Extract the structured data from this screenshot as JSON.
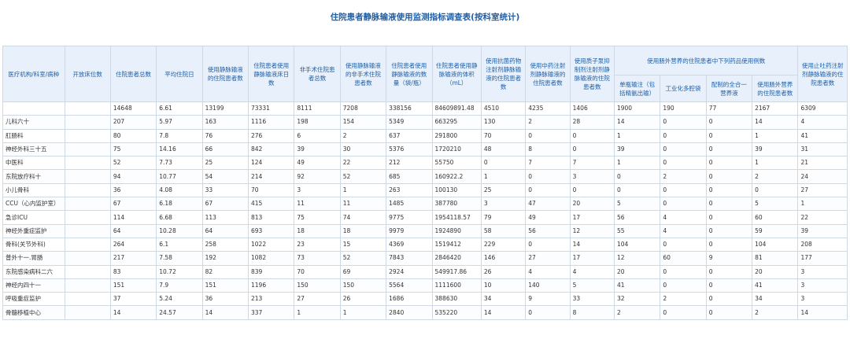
{
  "title": "住院患者静脉输液使用监测指标调查表(按科室统计)",
  "headers": {
    "dept": "医疗机构/科室/病种",
    "beds": "开放床位数",
    "inpatients": "住院患者总数",
    "avg_stay": "平均住院日",
    "iv_patients": "使用静脉输液的住院患者数",
    "iv_bed_days": "住院患者使用静脉输液床日数",
    "non_surgical": "非手术住院患者总数",
    "non_surgical_iv": "使用静脉输液的非手术住院患者数",
    "iv_amount": "住院患者使用静脉输液的数量（袋/瓶）",
    "iv_volume": "住院患者使用静脉输液的体积（mL）",
    "antibiotic_iv": "使用抗菌药物注射剂静脉输液的住院患者数",
    "tcm_iv": "使用中药注射剂静脉输液的住院患者数",
    "pump_iv": "使用质子泵抑制剂注射剂静脉输液的住院患者数",
    "parenteral_group": "使用肠外营养的住院患者中下列药品使用例数",
    "single_bottle": "单瓶输注（包括精氨出输）",
    "industrial_bags": "工业化多腔袋",
    "compounded": "配制的全合一营养液",
    "parenteral_patients": "使用肠外营养的住院患者数",
    "antiemetic_iv": "使用止吐药注射剂静脉输液的住院患者数"
  },
  "rows": [
    {
      "dept": "",
      "beds": "",
      "inpatients": "14648",
      "avg_stay": "6.61",
      "iv_patients": "13199",
      "iv_bed_days": "73331",
      "non_surgical": "8111",
      "non_surgical_iv": "7208",
      "iv_amount": "338156",
      "iv_volume": "84609891.48",
      "antibiotic_iv": "4510",
      "tcm_iv": "4235",
      "pump_iv": "1406",
      "single_bottle": "1900",
      "industrial_bags": "190",
      "compounded": "77",
      "parenteral_patients": "2167",
      "antiemetic_iv": "6309"
    },
    {
      "dept": "儿科六十",
      "beds": "",
      "inpatients": "207",
      "avg_stay": "5.97",
      "iv_patients": "163",
      "iv_bed_days": "1116",
      "non_surgical": "198",
      "non_surgical_iv": "154",
      "iv_amount": "5349",
      "iv_volume": "663295",
      "antibiotic_iv": "130",
      "tcm_iv": "2",
      "pump_iv": "28",
      "single_bottle": "14",
      "industrial_bags": "0",
      "compounded": "0",
      "parenteral_patients": "14",
      "antiemetic_iv": "4"
    },
    {
      "dept": "肛肠科",
      "beds": "",
      "inpatients": "80",
      "avg_stay": "7.8",
      "iv_patients": "76",
      "iv_bed_days": "276",
      "non_surgical": "6",
      "non_surgical_iv": "2",
      "iv_amount": "637",
      "iv_volume": "291800",
      "antibiotic_iv": "70",
      "tcm_iv": "0",
      "pump_iv": "0",
      "single_bottle": "1",
      "industrial_bags": "0",
      "compounded": "0",
      "parenteral_patients": "1",
      "antiemetic_iv": "41"
    },
    {
      "dept": "神经外科三十五",
      "beds": "",
      "inpatients": "75",
      "avg_stay": "14.16",
      "iv_patients": "66",
      "iv_bed_days": "842",
      "non_surgical": "39",
      "non_surgical_iv": "30",
      "iv_amount": "5376",
      "iv_volume": "1720210",
      "antibiotic_iv": "48",
      "tcm_iv": "8",
      "pump_iv": "0",
      "single_bottle": "39",
      "industrial_bags": "0",
      "compounded": "0",
      "parenteral_patients": "39",
      "antiemetic_iv": "31"
    },
    {
      "dept": "中医科",
      "beds": "",
      "inpatients": "52",
      "avg_stay": "7.73",
      "iv_patients": "25",
      "iv_bed_days": "124",
      "non_surgical": "49",
      "non_surgical_iv": "22",
      "iv_amount": "212",
      "iv_volume": "55750",
      "antibiotic_iv": "0",
      "tcm_iv": "7",
      "pump_iv": "7",
      "single_bottle": "1",
      "industrial_bags": "0",
      "compounded": "0",
      "parenteral_patients": "1",
      "antiemetic_iv": "21"
    },
    {
      "dept": "东院放疗科十",
      "beds": "",
      "inpatients": "94",
      "avg_stay": "10.77",
      "iv_patients": "54",
      "iv_bed_days": "214",
      "non_surgical": "92",
      "non_surgical_iv": "52",
      "iv_amount": "685",
      "iv_volume": "160922.2",
      "antibiotic_iv": "1",
      "tcm_iv": "0",
      "pump_iv": "3",
      "single_bottle": "0",
      "industrial_bags": "2",
      "compounded": "0",
      "parenteral_patients": "2",
      "antiemetic_iv": "24"
    },
    {
      "dept": "小儿骨科",
      "beds": "",
      "inpatients": "36",
      "avg_stay": "4.08",
      "iv_patients": "33",
      "iv_bed_days": "70",
      "non_surgical": "3",
      "non_surgical_iv": "1",
      "iv_amount": "263",
      "iv_volume": "100130",
      "antibiotic_iv": "25",
      "tcm_iv": "0",
      "pump_iv": "0",
      "single_bottle": "0",
      "industrial_bags": "0",
      "compounded": "0",
      "parenteral_patients": "0",
      "antiemetic_iv": "27"
    },
    {
      "dept": "CCU（心内监护室）",
      "beds": "",
      "inpatients": "67",
      "avg_stay": "6.18",
      "iv_patients": "67",
      "iv_bed_days": "415",
      "non_surgical": "11",
      "non_surgical_iv": "11",
      "iv_amount": "1485",
      "iv_volume": "387780",
      "antibiotic_iv": "3",
      "tcm_iv": "47",
      "pump_iv": "20",
      "single_bottle": "5",
      "industrial_bags": "0",
      "compounded": "0",
      "parenteral_patients": "5",
      "antiemetic_iv": "1"
    },
    {
      "dept": "急诊ICU",
      "beds": "",
      "inpatients": "114",
      "avg_stay": "6.68",
      "iv_patients": "113",
      "iv_bed_days": "813",
      "non_surgical": "75",
      "non_surgical_iv": "74",
      "iv_amount": "9775",
      "iv_volume": "1954118.57",
      "antibiotic_iv": "79",
      "tcm_iv": "49",
      "pump_iv": "17",
      "single_bottle": "56",
      "industrial_bags": "4",
      "compounded": "0",
      "parenteral_patients": "60",
      "antiemetic_iv": "22"
    },
    {
      "dept": "神经外重症监护",
      "beds": "",
      "inpatients": "64",
      "avg_stay": "10.28",
      "iv_patients": "64",
      "iv_bed_days": "693",
      "non_surgical": "18",
      "non_surgical_iv": "18",
      "iv_amount": "9979",
      "iv_volume": "1924890",
      "antibiotic_iv": "58",
      "tcm_iv": "56",
      "pump_iv": "12",
      "single_bottle": "55",
      "industrial_bags": "4",
      "compounded": "0",
      "parenteral_patients": "59",
      "antiemetic_iv": "39"
    },
    {
      "dept": "骨科(关节外科)",
      "beds": "",
      "inpatients": "264",
      "avg_stay": "6.1",
      "iv_patients": "258",
      "iv_bed_days": "1022",
      "non_surgical": "23",
      "non_surgical_iv": "15",
      "iv_amount": "4369",
      "iv_volume": "1519412",
      "antibiotic_iv": "229",
      "tcm_iv": "0",
      "pump_iv": "14",
      "single_bottle": "104",
      "industrial_bags": "0",
      "compounded": "0",
      "parenteral_patients": "104",
      "antiemetic_iv": "208"
    },
    {
      "dept": "普外十一.胃肠",
      "beds": "",
      "inpatients": "217",
      "avg_stay": "7.58",
      "iv_patients": "192",
      "iv_bed_days": "1082",
      "non_surgical": "73",
      "non_surgical_iv": "52",
      "iv_amount": "7843",
      "iv_volume": "2846420",
      "antibiotic_iv": "146",
      "tcm_iv": "27",
      "pump_iv": "17",
      "single_bottle": "12",
      "industrial_bags": "60",
      "compounded": "9",
      "parenteral_patients": "81",
      "antiemetic_iv": "177"
    },
    {
      "dept": "东院感染病科二六",
      "beds": "",
      "inpatients": "83",
      "avg_stay": "10.72",
      "iv_patients": "82",
      "iv_bed_days": "839",
      "non_surgical": "70",
      "non_surgical_iv": "69",
      "iv_amount": "2924",
      "iv_volume": "549917.86",
      "antibiotic_iv": "26",
      "tcm_iv": "4",
      "pump_iv": "4",
      "single_bottle": "20",
      "industrial_bags": "0",
      "compounded": "0",
      "parenteral_patients": "20",
      "antiemetic_iv": "3"
    },
    {
      "dept": "神经内四十一",
      "beds": "",
      "inpatients": "151",
      "avg_stay": "7.9",
      "iv_patients": "151",
      "iv_bed_days": "1196",
      "non_surgical": "150",
      "non_surgical_iv": "150",
      "iv_amount": "5564",
      "iv_volume": "1111600",
      "antibiotic_iv": "10",
      "tcm_iv": "140",
      "pump_iv": "5",
      "single_bottle": "41",
      "industrial_bags": "0",
      "compounded": "0",
      "parenteral_patients": "41",
      "antiemetic_iv": "3"
    },
    {
      "dept": "呼吸重症监护",
      "beds": "",
      "inpatients": "37",
      "avg_stay": "5.24",
      "iv_patients": "36",
      "iv_bed_days": "213",
      "non_surgical": "27",
      "non_surgical_iv": "26",
      "iv_amount": "1686",
      "iv_volume": "388630",
      "antibiotic_iv": "34",
      "tcm_iv": "9",
      "pump_iv": "33",
      "single_bottle": "32",
      "industrial_bags": "2",
      "compounded": "0",
      "parenteral_patients": "34",
      "antiemetic_iv": "3"
    },
    {
      "dept": "骨髓移植中心",
      "beds": "",
      "inpatients": "14",
      "avg_stay": "24.57",
      "iv_patients": "14",
      "iv_bed_days": "337",
      "non_surgical": "1",
      "non_surgical_iv": "1",
      "iv_amount": "2840",
      "iv_volume": "535220",
      "antibiotic_iv": "14",
      "tcm_iv": "0",
      "pump_iv": "8",
      "single_bottle": "2",
      "industrial_bags": "0",
      "compounded": "0",
      "parenteral_patients": "2",
      "antiemetic_iv": "14"
    }
  ]
}
